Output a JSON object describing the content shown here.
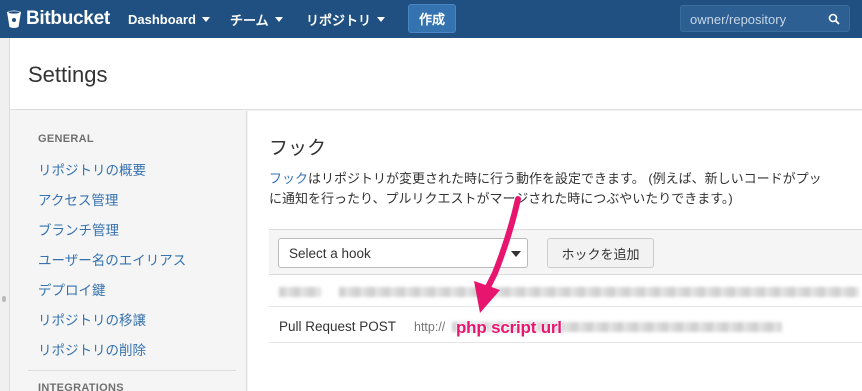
{
  "app": {
    "name": "Bitbucket"
  },
  "nav": {
    "dashboard": "Dashboard",
    "teams": "チーム",
    "repositories": "リポジトリ",
    "create": "作成",
    "search_placeholder": "owner/repository"
  },
  "page": {
    "title": "Settings"
  },
  "sidebar": {
    "general_heading": "GENERAL",
    "items": [
      {
        "label": "リポジトリの概要"
      },
      {
        "label": "アクセス管理"
      },
      {
        "label": "ブランチ管理"
      },
      {
        "label": "ユーザー名のエイリアス"
      },
      {
        "label": "デプロイ鍵"
      },
      {
        "label": "リポジトリの移譲"
      },
      {
        "label": "リポジトリの削除"
      }
    ],
    "integrations_heading": "INTEGRATIONS"
  },
  "main": {
    "heading": "フック",
    "desc_link": "フック",
    "desc_line1_rest": "はリポジトリが変更された時に行う動作を設定できます。 (例えば、新しいコードがプッ",
    "desc_line2": "に通知を行ったり、プルリクエストがマージされた時につぶやいたりできます。)",
    "select_value": "Select a hook",
    "add_button": "ホックを追加",
    "hooks": [
      {
        "name": "",
        "url": ""
      },
      {
        "name": "Pull Request POST",
        "url": "http://"
      }
    ]
  },
  "annotation": {
    "text": "php script url",
    "color": "#e8156f"
  },
  "colors": {
    "nav_bg": "#205081",
    "link": "#3572b0",
    "create_btn": "#3572b0"
  }
}
